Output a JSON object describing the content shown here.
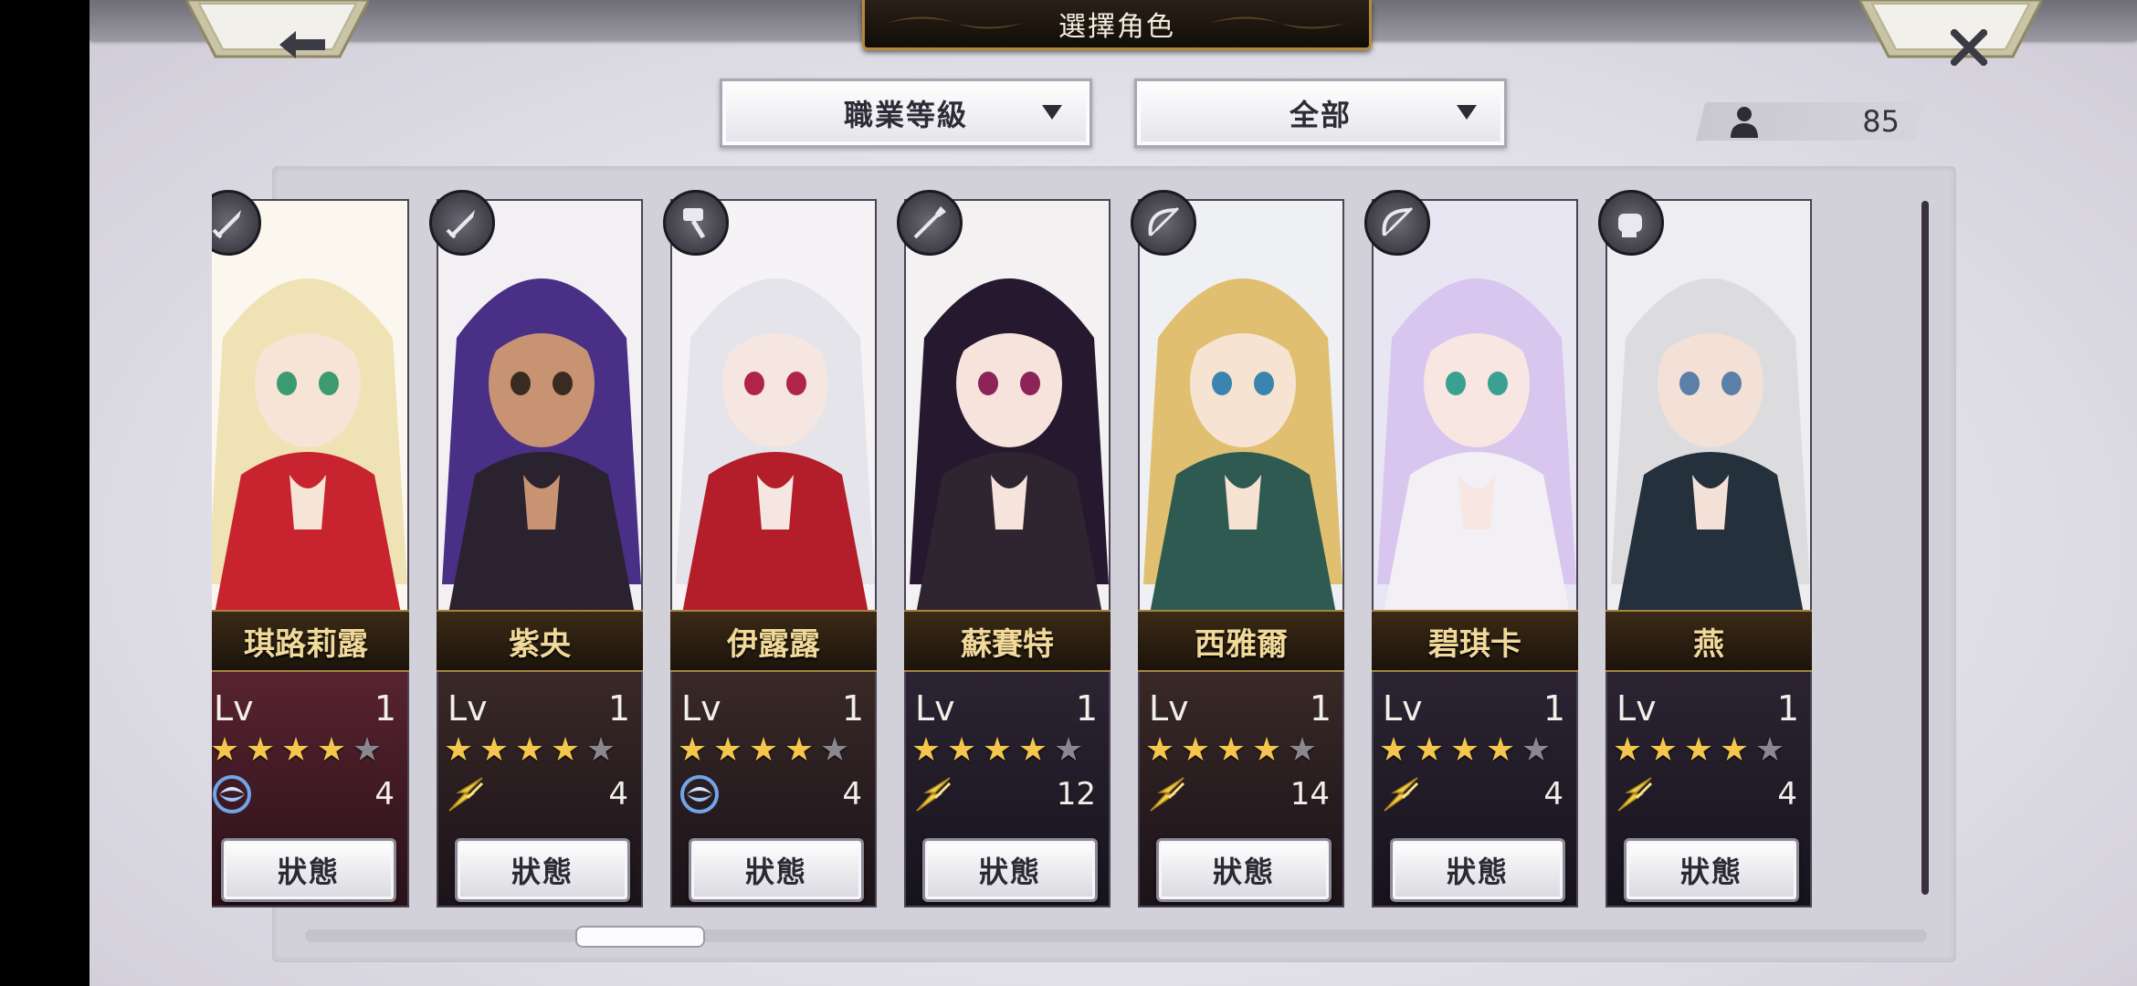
{
  "header": {
    "title": "選擇角色",
    "back_icon": "back-arrow-icon",
    "close_icon": "close-icon"
  },
  "filters": {
    "sort": {
      "selected": "職業等級"
    },
    "category": {
      "selected": "全部"
    }
  },
  "roster": {
    "count": "85",
    "icon": "person-icon"
  },
  "cards": [
    {
      "name": "琪路莉露",
      "lv_label": "Lv",
      "level": "1",
      "stars": 4,
      "max_stars": 5,
      "element": "wind",
      "cost": "4",
      "button": "狀態",
      "class_icon": "sword-icon"
    },
    {
      "name": "紫央",
      "lv_label": "Lv",
      "level": "1",
      "stars": 4,
      "max_stars": 5,
      "element": "lightning",
      "cost": "4",
      "button": "狀態",
      "class_icon": "sword-icon"
    },
    {
      "name": "伊露露",
      "lv_label": "Lv",
      "level": "1",
      "stars": 4,
      "max_stars": 5,
      "element": "wind",
      "cost": "4",
      "button": "狀態",
      "class_icon": "hammer-icon"
    },
    {
      "name": "蘇賽特",
      "lv_label": "Lv",
      "level": "1",
      "stars": 4,
      "max_stars": 5,
      "element": "lightning",
      "cost": "12",
      "button": "狀態",
      "class_icon": "spear-icon"
    },
    {
      "name": "西雅爾",
      "lv_label": "Lv",
      "level": "1",
      "stars": 4,
      "max_stars": 5,
      "element": "lightning",
      "cost": "14",
      "button": "狀態",
      "class_icon": "bow-icon"
    },
    {
      "name": "碧琪卡",
      "lv_label": "Lv",
      "level": "1",
      "stars": 4,
      "max_stars": 5,
      "element": "lightning",
      "cost": "4",
      "button": "狀態",
      "class_icon": "bow-icon"
    },
    {
      "name": "燕",
      "lv_label": "Lv",
      "level": "1",
      "stars": 4,
      "max_stars": 5,
      "element": "lightning",
      "cost": "4",
      "button": "狀態",
      "class_icon": "fist-icon"
    }
  ],
  "colors": {
    "star_on": "#f4c64e",
    "star_off": "#8b8790",
    "name_gold": "#f1d99a"
  }
}
